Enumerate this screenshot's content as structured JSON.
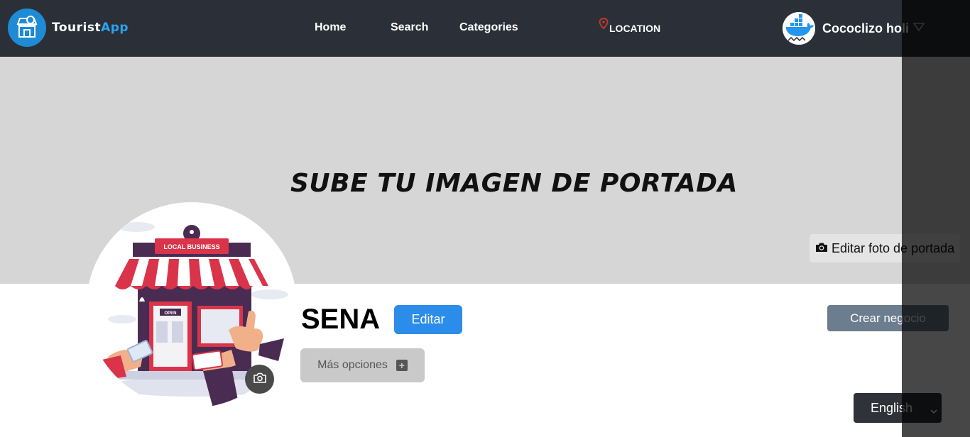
{
  "navbar": {
    "logo": {
      "brand_prefix": "Tourist",
      "brand_suffix": "App",
      "icon": "storefront-icon"
    },
    "links": {
      "home": "Home",
      "search": "Search",
      "categories": "Categories"
    },
    "location": {
      "label": "LOCATION",
      "icon": "map-pin-icon",
      "color": "#c0392b"
    },
    "user": {
      "name": "Cococlizo holi",
      "avatar_icon": "docker-whale-icon",
      "caret_icon": "chevron-down-icon"
    }
  },
  "cover": {
    "placeholder_text": "SUBE TU IMAGEN DE PORTADA",
    "edit_button_label": "Editar foto de portada",
    "edit_button_icon": "camera-icon",
    "background_color": "#d6d6d6"
  },
  "profile": {
    "image_icon": "local-business-store-icon",
    "store_sign": "LOCAL BUSINESS",
    "door_sign": "OPEN",
    "camera_icon": "camera-icon",
    "business_name": "SENA",
    "edit_label": "Editar",
    "more_options_label": "Más opciones",
    "more_options_icon": "plus-icon",
    "create_business_label": "Crear negocio"
  },
  "language_select": {
    "selected": "English",
    "icon": "chevron-down-icon"
  },
  "colors": {
    "navbar": "#2b2f38",
    "primary": "#2b8cea",
    "brand_accent": "#2aa5f0",
    "secondary": "#6c7d8f"
  }
}
